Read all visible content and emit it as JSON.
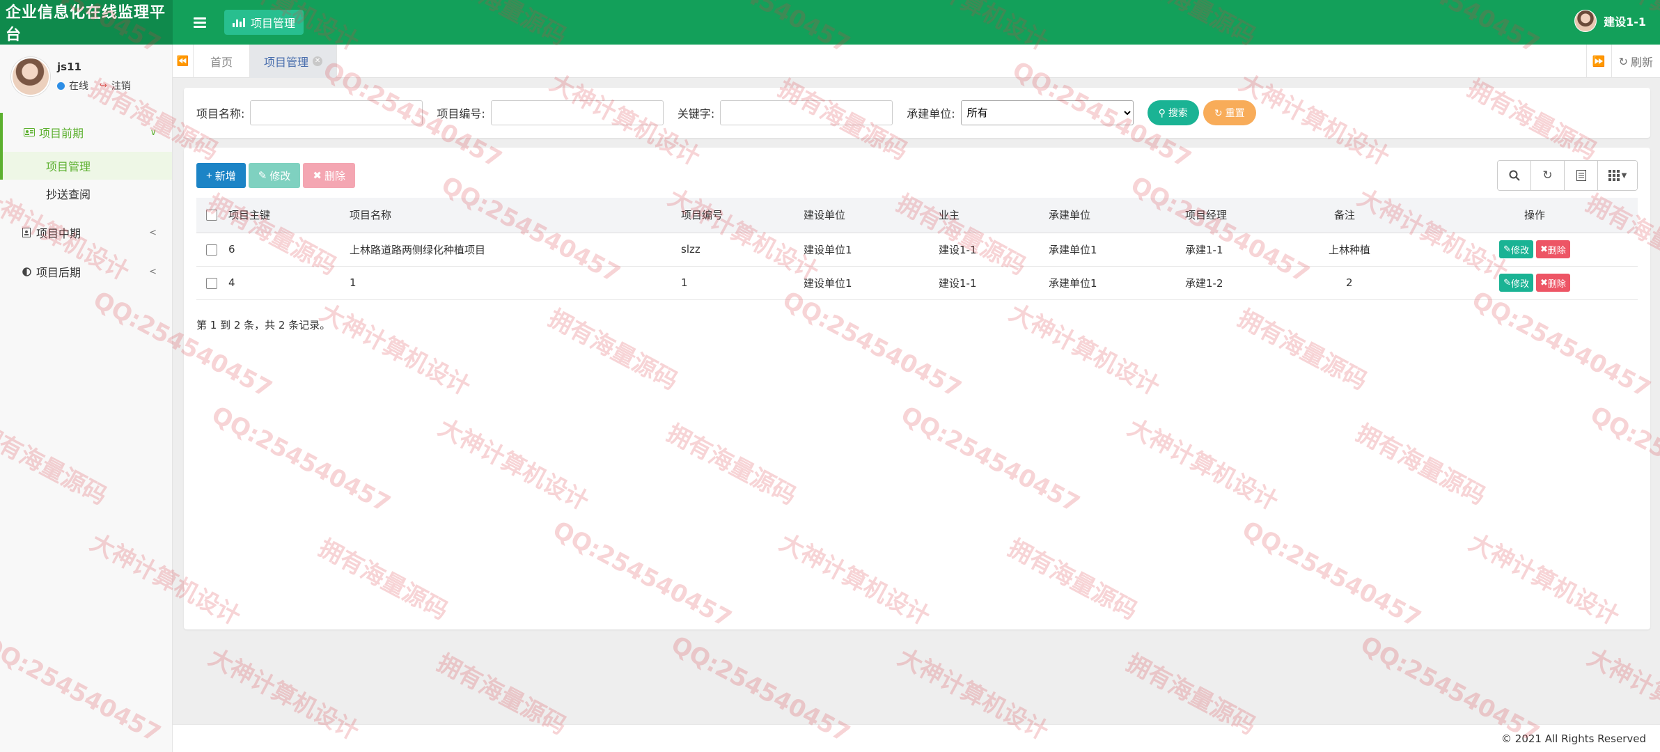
{
  "app": {
    "title": "企业信息化在线监理平台",
    "top_tab": "项目管理",
    "user": "建设1-1"
  },
  "sidebar": {
    "user_name": "js11",
    "status_online": "在线",
    "logout": "注销",
    "groups": [
      {
        "label": "项目前期",
        "icon": "id-card-icon",
        "items": [
          "项目管理",
          "抄送查阅"
        ]
      },
      {
        "label": "项目中期",
        "icon": "file-icon"
      },
      {
        "label": "项目后期",
        "icon": "half-circle-icon"
      }
    ]
  },
  "tabs": {
    "home": "首页",
    "current": "项目管理",
    "refresh": "刷新"
  },
  "search": {
    "name_label": "项目名称:",
    "name_value": "",
    "code_label": "项目编号:",
    "code_value": "",
    "keyword_label": "关键字:",
    "keyword_value": "",
    "unit_label": "承建单位:",
    "unit_selected": "所有",
    "search_button": "搜索",
    "reset_button": "重置"
  },
  "toolbar": {
    "add": "新增",
    "edit": "修改",
    "delete": "删除"
  },
  "table": {
    "headers": [
      "项目主键",
      "项目名称",
      "项目编号",
      "建设单位",
      "业主",
      "承建单位",
      "项目经理",
      "备注",
      "操作"
    ],
    "rows": [
      [
        "6",
        "上林路道路两侧绿化种植项目",
        "slzz",
        "建设单位1",
        "建设1-1",
        "承建单位1",
        "承建1-1",
        "上林种植"
      ],
      [
        "4",
        "1",
        "1",
        "建设单位1",
        "建设1-1",
        "承建单位1",
        "承建1-2",
        "2"
      ]
    ],
    "row_edit": "修改",
    "row_delete": "删除",
    "pagination": "第 1 到 2 条，共 2 条记录。"
  },
  "footer": {
    "copyright": "© 2021 All Rights Reserved"
  },
  "watermarks": [
    "QQ:254540457",
    "大神计算机设计",
    "拥有海量源码"
  ],
  "colors": {
    "topbar": "#13a05a",
    "brand_bg": "#0f8a4c",
    "sidebar_active": "#5cb02f",
    "search_btn": "#1ab394",
    "reset_btn": "#f8ac59",
    "add_btn": "#1c84c6",
    "delete_btn": "#ed5565"
  }
}
